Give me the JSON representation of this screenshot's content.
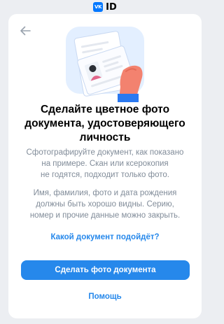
{
  "brand": {
    "logo_text": "VK",
    "name": "ID"
  },
  "header": {
    "back_icon": "arrow-left-icon"
  },
  "illustration": {
    "icon": "passport-in-hand-illustration"
  },
  "content": {
    "title": "Сделайте цветное фото\nдокумента, удостоверяющего\nличность",
    "paragraph_1": "Сфотографируйте документ, как показано\nна примере. Скан или ксерокопия\nне годятся, подходит только фото.",
    "paragraph_2": "Имя, фамилия, фото и дата рождения\nдолжны быть хорошо видны. Серию,\nномер и прочие данные можно закрыть."
  },
  "actions": {
    "which_document_link": "Какой документ подойдёт?",
    "take_photo_button": "Сделать фото документа",
    "help_link": "Помощь"
  },
  "colors": {
    "accent": "#2688eb",
    "background": "#eceef2",
    "secondary_text": "#818c99"
  }
}
